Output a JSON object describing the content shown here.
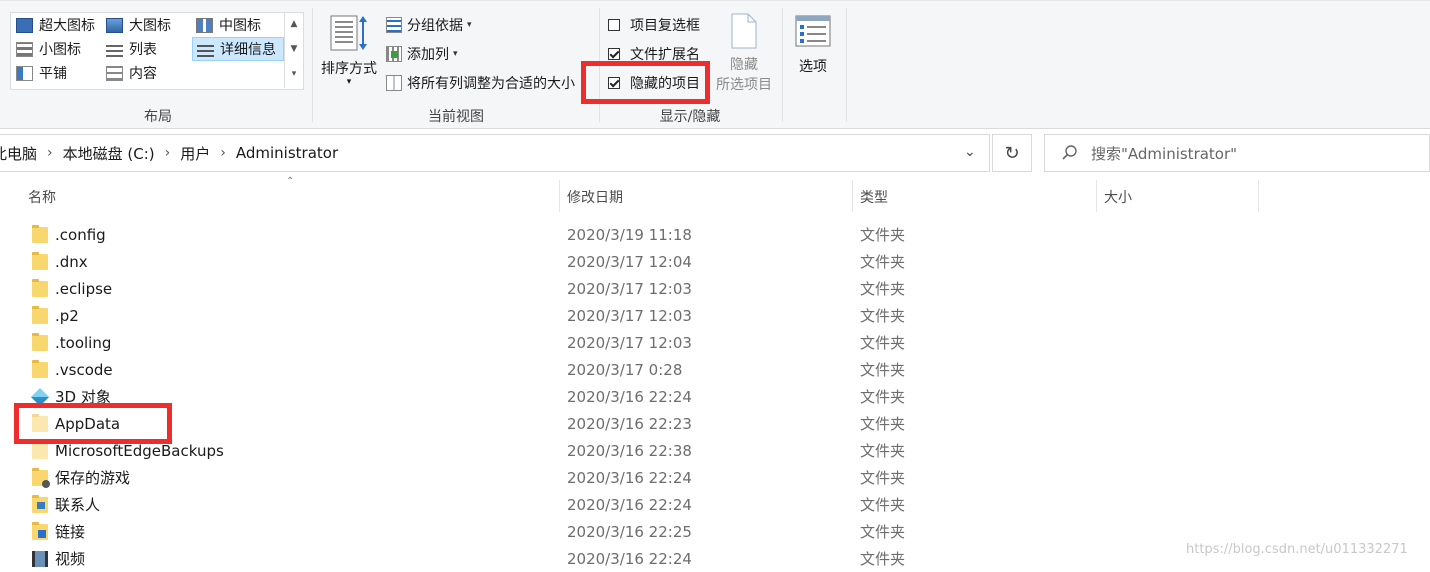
{
  "ribbon": {
    "layout": {
      "items": [
        {
          "label": "超大图标",
          "icon": "extra-large-icons-icon"
        },
        {
          "label": "大图标",
          "icon": "large-icons-icon"
        },
        {
          "label": "中图标",
          "icon": "medium-icons-icon"
        },
        {
          "label": "小图标",
          "icon": "small-icons-icon"
        },
        {
          "label": "列表",
          "icon": "list-icon"
        },
        {
          "label": "详细信息",
          "icon": "details-icon",
          "selected": true
        },
        {
          "label": "平铺",
          "icon": "tiles-icon"
        },
        {
          "label": "内容",
          "icon": "content-icon"
        }
      ],
      "group_label": "布局"
    },
    "current_view": {
      "sort_by": "排序方式",
      "group_by": "分组依据",
      "add_columns": "添加列",
      "size_all_columns": "将所有列调整为合适的大小",
      "group_label": "当前视图"
    },
    "show_hide": {
      "item_checkboxes": {
        "label": "项目复选框",
        "checked": false
      },
      "file_extensions": {
        "label": "文件扩展名",
        "checked": true
      },
      "hidden_items": {
        "label": "隐藏的项目",
        "checked": true
      },
      "hide_selected_line1": "隐藏",
      "hide_selected_line2": "所选项目",
      "group_label": "显示/隐藏"
    },
    "options_label": "选项"
  },
  "address": {
    "crumbs": [
      "此电脑",
      "本地磁盘 (C:)",
      "用户",
      "Administrator"
    ],
    "search_placeholder": "搜索\"Administrator\""
  },
  "columns": {
    "name": "名称",
    "modified": "修改日期",
    "type": "类型",
    "size": "大小"
  },
  "files": [
    {
      "name": ".config",
      "date": "2020/3/19 11:18",
      "type": "文件夹",
      "icon": "folder-icon"
    },
    {
      "name": ".dnx",
      "date": "2020/3/17 12:04",
      "type": "文件夹",
      "icon": "folder-icon"
    },
    {
      "name": ".eclipse",
      "date": "2020/3/17 12:03",
      "type": "文件夹",
      "icon": "folder-icon"
    },
    {
      "name": ".p2",
      "date": "2020/3/17 12:03",
      "type": "文件夹",
      "icon": "folder-icon"
    },
    {
      "name": ".tooling",
      "date": "2020/3/17 12:03",
      "type": "文件夹",
      "icon": "folder-icon"
    },
    {
      "name": ".vscode",
      "date": "2020/3/17 0:28",
      "type": "文件夹",
      "icon": "folder-icon"
    },
    {
      "name": "3D 对象",
      "date": "2020/3/16 22:24",
      "type": "文件夹",
      "icon": "3d-objects-icon"
    },
    {
      "name": "AppData",
      "date": "2020/3/16 22:23",
      "type": "文件夹",
      "icon": "hidden-folder-icon"
    },
    {
      "name": "MicrosoftEdgeBackups",
      "date": "2020/3/16 22:38",
      "type": "文件夹",
      "icon": "hidden-folder-icon"
    },
    {
      "name": "保存的游戏",
      "date": "2020/3/16 22:24",
      "type": "文件夹",
      "icon": "saved-games-icon"
    },
    {
      "name": "联系人",
      "date": "2020/3/16 22:24",
      "type": "文件夹",
      "icon": "contacts-icon"
    },
    {
      "name": "链接",
      "date": "2020/3/16 22:25",
      "type": "文件夹",
      "icon": "links-icon"
    },
    {
      "name": "视频",
      "date": "2020/3/16 22:24",
      "type": "文件夹",
      "icon": "videos-icon"
    }
  ],
  "colors": {
    "highlight_red": "#ef2d2d",
    "selected_bg": "#cce8ff",
    "folder": "#f9d76f"
  },
  "watermark": "https://blog.csdn.net/u011332271"
}
